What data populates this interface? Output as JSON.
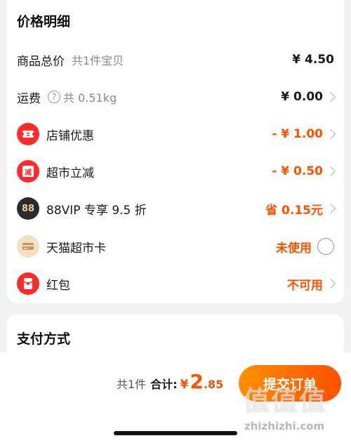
{
  "price_card": {
    "title": "价格明细",
    "rows": [
      {
        "label": "商品总价",
        "sub": "共1件宝贝",
        "value": "¥ 4.50"
      },
      {
        "label": "运费",
        "sub": "共 0.51kg",
        "value": "¥ 0.00"
      },
      {
        "label": "店铺优惠",
        "value": "- ¥ 1.00",
        "icon": "shop-coupon-icon",
        "icon_color": "#ff2a2a"
      },
      {
        "label": "超市立减",
        "value": "- ¥ 0.50",
        "icon": "supermarket-discount-icon",
        "icon_color": "#ff2a2a",
        "icon_glyph": "减"
      },
      {
        "label": "88VIP 专享 9.5 折",
        "value": "省 0.15元",
        "icon": "88vip-icon",
        "icon_color": "#2b2b2b",
        "icon_glyph": "88"
      },
      {
        "label": "天猫超市卡",
        "value": "未使用",
        "icon": "tmall-card-icon",
        "icon_color": "#f3dfc4"
      },
      {
        "label": "红包",
        "value": "不可用",
        "icon": "red-packet-icon",
        "icon_color": "#ff2a2a"
      }
    ]
  },
  "payment_card": {
    "title": "支付方式"
  },
  "footer": {
    "count": "共1件",
    "total_label": "合计:",
    "currency": "¥",
    "total_int": "2",
    "total_dec": ".85",
    "submit_label": "提交订单"
  },
  "watermark": {
    "glyphs": "值值值",
    "url": "zhizhizhi.com"
  },
  "colors": {
    "accent": "#ff5000",
    "button_gradient_start": "#ff9000",
    "button_gradient_end": "#ff5000"
  }
}
